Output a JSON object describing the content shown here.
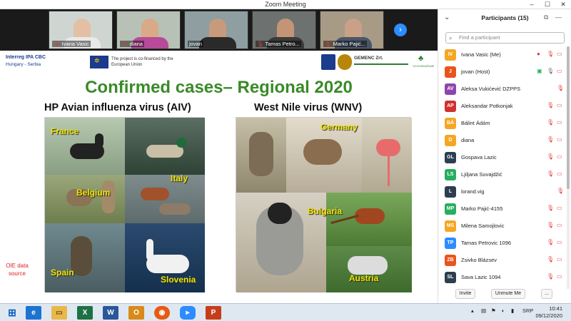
{
  "window": {
    "title": "Zoom Meeting"
  },
  "video_strip": {
    "participants": [
      {
        "name": "Ivana Vasic"
      },
      {
        "name": "diana"
      },
      {
        "name": "jovan"
      },
      {
        "name": "Tamas Petro..."
      },
      {
        "name": "Marko Pajić..."
      }
    ]
  },
  "slide": {
    "logos": {
      "interreg": "Interreg IPA CBC",
      "interreg_sub": "Hungary - Serbia",
      "eu_note": "The project is co-financed by the European Union",
      "gemenc": "GEMENC Zrt.",
      "vojvodina": "VOJVODINAŠUME"
    },
    "title": "Confirmed cases– Regional 2020",
    "left_heading": "HP Avian influenza virus (AIV)",
    "right_heading": "West Nile virus (WNV)",
    "aiv_labels": [
      "France",
      "Italy",
      "Belgium",
      "Spain",
      "Slovenia"
    ],
    "wnv_labels": [
      "Germany",
      "Bulgaria",
      "Austria"
    ],
    "source_note": "OIE data source"
  },
  "participants_panel": {
    "title": "Participants (15)",
    "search_placeholder": "Find a participant",
    "participants": [
      {
        "initials": "IV",
        "name": "Ivana Vasic (Me)",
        "color": "#f5a623"
      },
      {
        "initials": "J",
        "name": "jovan (Host)",
        "color": "#e8541e"
      },
      {
        "initials": "AV",
        "name": "Aleksa Vukićević DZPPS",
        "color": "#8e44ad"
      },
      {
        "initials": "AP",
        "name": "Aleksandar Potkonjak",
        "color": "#d0312d"
      },
      {
        "initials": "BÁ",
        "name": "Bálint Ádám",
        "color": "#f5a623"
      },
      {
        "initials": "D",
        "name": "diana",
        "color": "#f5a623"
      },
      {
        "initials": "GL",
        "name": "Gospava Lazic",
        "color": "#2c3e50"
      },
      {
        "initials": "LS",
        "name": "Ljiljana Suvajdžić",
        "color": "#27ae60"
      },
      {
        "initials": "L",
        "name": "lorand.vig",
        "color": "#2c3e50"
      },
      {
        "initials": "MP",
        "name": "Marko Pajić-4155",
        "color": "#27ae60"
      },
      {
        "initials": "MS",
        "name": "Milena Samojlovic",
        "color": "#f5a623"
      },
      {
        "initials": "TP",
        "name": "Tamas Petrovic 1096",
        "color": "#2d8cff"
      },
      {
        "initials": "ZB",
        "name": "Zsivko Blázsev",
        "color": "#e8541e"
      },
      {
        "initials": "SL",
        "name": "Sava Lazic 1094",
        "color": "#2c3e50"
      }
    ],
    "buttons": {
      "invite": "Invite",
      "unmute": "Unmute Me",
      "more": "..."
    }
  },
  "taskbar": {
    "language": "SRP",
    "time": "10:41",
    "date": "09/12/2020"
  }
}
